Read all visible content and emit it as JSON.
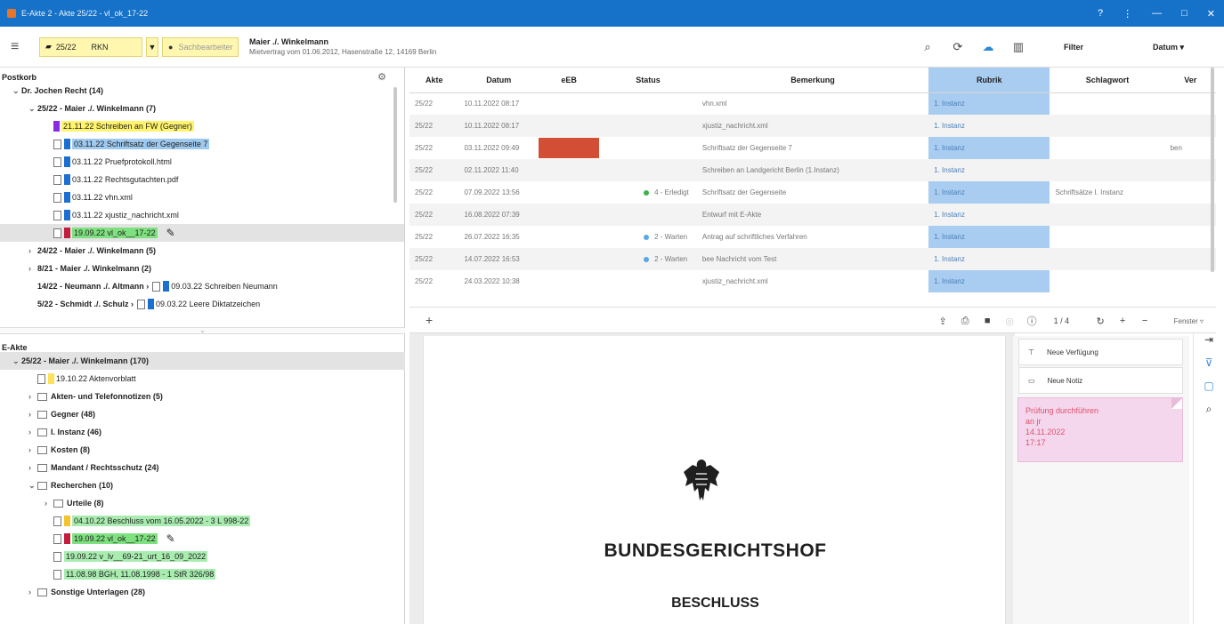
{
  "window": {
    "title": "E-Akte 2 - Akte 25/22 - vl_ok_17-22",
    "controls": [
      "?",
      "⋮",
      "—",
      "□",
      "✕"
    ]
  },
  "toolbar": {
    "akte_number": "25/22",
    "akte_code": "RKN",
    "user_placeholder": "Sachbearbeiter",
    "case_title": "Maier ./. Winkelmann",
    "case_subtitle": "Mietvertrag vom 01.06.2012, Hasenstraße 12, 14169 Berlin",
    "filter_label": "Filter",
    "datum_label": "Datum ▾"
  },
  "postkorb": {
    "title": "Postkorb",
    "items": [
      {
        "indent": 0,
        "caret": "⌄",
        "bold": true,
        "text": "Dr. Jochen Recht (14)"
      },
      {
        "indent": 1,
        "caret": "⌄",
        "bold": true,
        "text": "25/22 - Maier ./. Winkelmann (7)"
      },
      {
        "indent": 2,
        "chip": "#8a2be2",
        "hl": "yellow",
        "text": "21.11.22 Schreiben an FW (Gegner)"
      },
      {
        "indent": 2,
        "doc": true,
        "chip": "#1a6fd1",
        "hl": "blue",
        "text": "03.11.22 Schriftsatz der Gegenseite 7"
      },
      {
        "indent": 2,
        "doc": true,
        "chip": "#1a6fd1",
        "text": "03.11.22 Pruefprotokoll.html"
      },
      {
        "indent": 2,
        "doc": true,
        "chip": "#1a6fd1",
        "text": "03.11.22 Rechtsgutachten.pdf"
      },
      {
        "indent": 2,
        "doc": true,
        "chip": "#1a6fd1",
        "text": "03.11.22 vhn.xml"
      },
      {
        "indent": 2,
        "doc": true,
        "chip": "#1a6fd1",
        "text": "03.11.22 xjustiz_nachricht.xml"
      },
      {
        "indent": 2,
        "doc": true,
        "chip": "#c21d3f",
        "hl": "green",
        "sel": true,
        "text": "19.09.22 vl_ok__17-22",
        "pencil": "✎"
      },
      {
        "indent": 1,
        "caret": "›",
        "bold": true,
        "text": "24/22 - Maier ./. Winkelmann (5)"
      },
      {
        "indent": 1,
        "caret": "›",
        "bold": true,
        "text": "8/21 - Maier ./. Winkelmann (2)"
      },
      {
        "indent": 1,
        "bold": true,
        "text": "14/22 - Neumann ./. Altmann ›",
        "tail": "09.03.22 Schreiben Neumann"
      },
      {
        "indent": 1,
        "bold": true,
        "text": "5/22 - Schmidt ./. Schulz ›",
        "tail": "09.03.22 Leere Diktatzeichen"
      }
    ]
  },
  "eakte": {
    "title": "E-Akte",
    "items": [
      {
        "indent": 0,
        "caret": "⌄",
        "bold": true,
        "sel": true,
        "text": "25/22 - Maier ./. Winkelmann (170)"
      },
      {
        "indent": 1,
        "doc": true,
        "chip": "#ffe05a",
        "text": "19.10.22 Aktenvorblatt"
      },
      {
        "indent": 1,
        "caret": "›",
        "folder": true,
        "bold": true,
        "text": "Akten- und Telefonnotizen (5)"
      },
      {
        "indent": 1,
        "caret": "›",
        "folder": true,
        "bold": true,
        "text": "Gegner (48)"
      },
      {
        "indent": 1,
        "caret": "›",
        "folder": true,
        "bold": true,
        "text": "I. Instanz (46)"
      },
      {
        "indent": 1,
        "caret": "›",
        "folder": true,
        "bold": true,
        "text": "Kosten (8)"
      },
      {
        "indent": 1,
        "caret": "›",
        "folder": true,
        "bold": true,
        "text": "Mandant / Rechtsschutz (24)"
      },
      {
        "indent": 1,
        "caret": "⌄",
        "folder": true,
        "bold": true,
        "text": "Recherchen (10)"
      },
      {
        "indent": 2,
        "caret": "›",
        "folder": true,
        "bold": true,
        "text": "Urteile (8)"
      },
      {
        "indent": 2,
        "doc": true,
        "chip": "#f4c430",
        "hl": "green2",
        "text": "04.10.22 Beschluss vom 16.05.2022 - 3 L 998-22"
      },
      {
        "indent": 2,
        "doc": true,
        "chip": "#c21d3f",
        "hl": "green",
        "text": "19.09.22 vl_ok__17-22",
        "pencil": "✎"
      },
      {
        "indent": 2,
        "doc": true,
        "hl": "green2",
        "text": "19.09.22 v_lv__69-21_urt_16_09_2022"
      },
      {
        "indent": 2,
        "doc": true,
        "hl": "green2",
        "text": "11.08.98 BGH, 11.08.1998 - 1 StR 326/98"
      },
      {
        "indent": 1,
        "caret": "›",
        "folder": true,
        "bold": true,
        "text": "Sonstige Unterlagen (28)"
      }
    ]
  },
  "grid": {
    "columns": [
      "Akte",
      "Datum",
      "eEB",
      "Status",
      "Bemerkung",
      "Rubrik",
      "Schlagwort",
      "Ver"
    ],
    "rows": [
      [
        "25/22",
        "10.11.2022 08:17",
        "",
        "",
        "vhn.xml",
        "1. Instanz",
        "",
        ""
      ],
      [
        "25/22",
        "10.11.2022 08:17",
        "",
        "",
        "xjustiz_nachricht.xml",
        "1. Instanz",
        "",
        ""
      ],
      [
        "25/22",
        "03.11.2022 09:49",
        "red",
        "",
        "Schriftsatz der Gegenseite 7",
        "1. Instanz",
        "",
        "ben"
      ],
      [
        "25/22",
        "02.11.2022 11:40",
        "",
        "",
        "Schreiben an Landgericht Berlin (1.Instanz)",
        "1. Instanz",
        "",
        ""
      ],
      [
        "25/22",
        "07.09.2022 13:56",
        "",
        "green|4 - Erledigt",
        "Schriftsatz der Gegenseite",
        "1. Instanz",
        "Schriftsätze I. Instanz",
        ""
      ],
      [
        "25/22",
        "16.08.2022 07:39",
        "",
        "",
        "Entwurf mit E-Akte",
        "1. Instanz",
        "",
        ""
      ],
      [
        "25/22",
        "26.07.2022 16:35",
        "",
        "blue|2 - Warten",
        "Antrag auf schriftliches Verfahren",
        "1. Instanz",
        "",
        ""
      ],
      [
        "25/22",
        "14.07.2022 16:53",
        "",
        "blue|2 - Warten",
        "bee Nachricht vom Test",
        "1. Instanz",
        "",
        ""
      ],
      [
        "25/22",
        "24.03.2022 10:38",
        "",
        "",
        "xjustiz_nachricht.xml",
        "1. Instanz",
        "",
        ""
      ]
    ]
  },
  "pdf": {
    "page_indicator": "1 / 4",
    "fenster": "Fenster ▿",
    "court": "BUNDESGERICHTSHOF",
    "doc_type": "BESCHLUSS"
  },
  "sidepanel": {
    "new_verfuegung": "Neue Verfügung",
    "new_notiz": "Neue Notiz",
    "note_lines": [
      "Prüfung durchführen",
      "an jr",
      "14.11.2022",
      "17:17"
    ]
  },
  "colors": {
    "accent": "#1672c9",
    "rubrik": "#a8cdf0",
    "note": "#f4d7ec",
    "ebb_red": "#d24e35"
  }
}
